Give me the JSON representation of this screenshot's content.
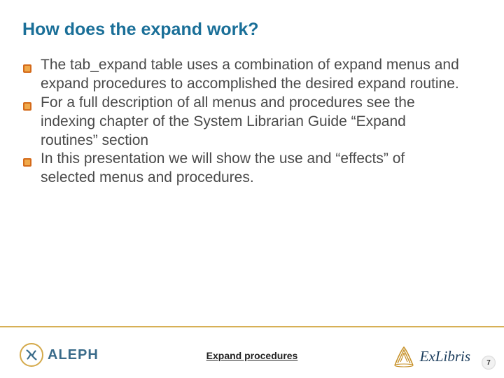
{
  "title": "How does the expand work?",
  "bullets": [
    "The tab_expand table uses a combination of expand menus and expand procedures to accomplished the desired expand routine.",
    "For a full description of all menus and procedures see the indexing chapter of the System Librarian Guide “Expand routines” section",
    "In this presentation we will show the use and “effects” of selected menus and procedures."
  ],
  "footer": {
    "center_text": "Expand procedures",
    "left_logo_text": "ALEPH",
    "right_logo_text": "ExLibris"
  },
  "page_number": "7",
  "colors": {
    "title": "#1a6f98",
    "body": "#4a4a4a",
    "rule": "#d4a94a",
    "exlibris": "#183a5a"
  }
}
